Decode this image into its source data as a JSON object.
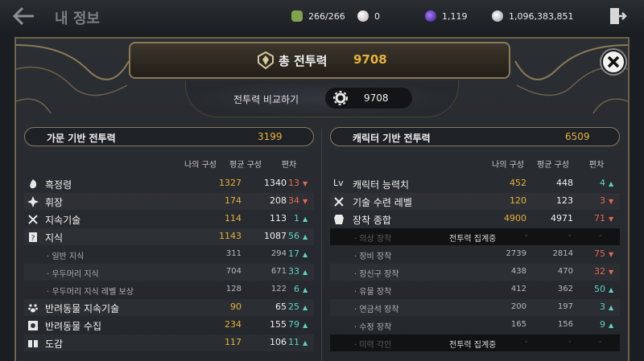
{
  "topbar": {
    "title": "내 정보",
    "resources": [
      {
        "icon": "stamina-icon",
        "value": "266/266",
        "color": "#7da34d"
      },
      {
        "icon": "pearl-icon",
        "value": "0",
        "color": "#d9d2d0"
      },
      {
        "icon": "crystal-icon",
        "value": "1,119",
        "color": "#6b3fc7"
      },
      {
        "icon": "silver-icon",
        "value": "1,096,383,851",
        "color": "#b9c4d6"
      }
    ]
  },
  "panel": {
    "title": "총 전투력",
    "total": "9708",
    "compare_label": "전투력 비교하기",
    "compare_value": "9708"
  },
  "family": {
    "title": "가문 기반 전투력",
    "value": "3199",
    "columns": [
      "나의 구성",
      "평균 구성",
      "편차"
    ],
    "rows": [
      {
        "icon": "black-spirit-icon",
        "label": "흑정령",
        "mine": "1327",
        "avg": "1340",
        "diff": "13",
        "dir": "down",
        "sub": false
      },
      {
        "icon": "crest-icon",
        "label": "휘장",
        "mine": "174",
        "avg": "208",
        "diff": "34",
        "dir": "down",
        "sub": false
      },
      {
        "icon": "crossed-tools-icon",
        "label": "지속기술",
        "mine": "114",
        "avg": "113",
        "diff": "1",
        "dir": "up",
        "sub": false
      },
      {
        "icon": "book-icon",
        "label": "지식",
        "mine": "1143",
        "avg": "1087",
        "diff": "56",
        "dir": "up",
        "sub": false
      },
      {
        "icon": "",
        "label": "· 일반 지식",
        "mine": "311",
        "avg": "294",
        "diff": "17",
        "dir": "up",
        "sub": true
      },
      {
        "icon": "",
        "label": "· 우두머리 지식",
        "mine": "704",
        "avg": "671",
        "diff": "33",
        "dir": "up",
        "sub": true
      },
      {
        "icon": "",
        "label": "· 우두머리 지식 레벨 보상",
        "mine": "128",
        "avg": "122",
        "diff": "6",
        "dir": "up",
        "sub": true
      },
      {
        "icon": "paw-icon",
        "label": "반려동물 지속기술",
        "mine": "90",
        "avg": "65",
        "diff": "25",
        "dir": "up",
        "sub": false
      },
      {
        "icon": "pet-collection-icon",
        "label": "반려동물 수집",
        "mine": "234",
        "avg": "155",
        "diff": "79",
        "dir": "up",
        "sub": false
      },
      {
        "icon": "codex-icon",
        "label": "도감",
        "mine": "117",
        "avg": "106",
        "diff": "11",
        "dir": "up",
        "sub": false
      }
    ]
  },
  "character": {
    "title": "캐릭터 기반 전투력",
    "value": "6509",
    "columns": [
      "나의 구성",
      "평균 구성",
      "편차"
    ],
    "rows": [
      {
        "icon": "lv-icon",
        "icon_text": "Lv",
        "label": "캐릭터 능력치",
        "mine": "452",
        "avg": "448",
        "diff": "4",
        "dir": "up",
        "kind": "main"
      },
      {
        "icon": "skill-train-icon",
        "label": "기술 수련 레벨",
        "mine": "120",
        "avg": "123",
        "diff": "3",
        "dir": "down",
        "kind": "main"
      },
      {
        "icon": "armor-icon",
        "label": "장착 종합",
        "mine": "4900",
        "avg": "4971",
        "diff": "71",
        "dir": "down",
        "kind": "main"
      },
      {
        "label": "· 의상 장착",
        "note": "전투력 집계중",
        "dash": "-",
        "kind": "note"
      },
      {
        "label": "· 장비 장착",
        "mine": "2739",
        "avg": "2814",
        "diff": "75",
        "dir": "down",
        "kind": "sub"
      },
      {
        "label": "· 장신구 장착",
        "mine": "438",
        "avg": "470",
        "diff": "32",
        "dir": "down",
        "kind": "sub"
      },
      {
        "label": "· 유물 장착",
        "mine": "412",
        "avg": "362",
        "diff": "50",
        "dir": "up",
        "kind": "sub"
      },
      {
        "label": "· 연금석 장착",
        "mine": "200",
        "avg": "197",
        "diff": "3",
        "dir": "up",
        "kind": "sub"
      },
      {
        "label": "· 수정 장착",
        "mine": "165",
        "avg": "156",
        "diff": "9",
        "dir": "up",
        "kind": "sub"
      },
      {
        "label": "· 미력 각인",
        "note": "전투력 집계중",
        "dash": "-",
        "kind": "note"
      }
    ]
  },
  "colors": {
    "gold": "#e5b23a",
    "teal_up": "#5fd3c6",
    "red_down": "#e26a52"
  }
}
